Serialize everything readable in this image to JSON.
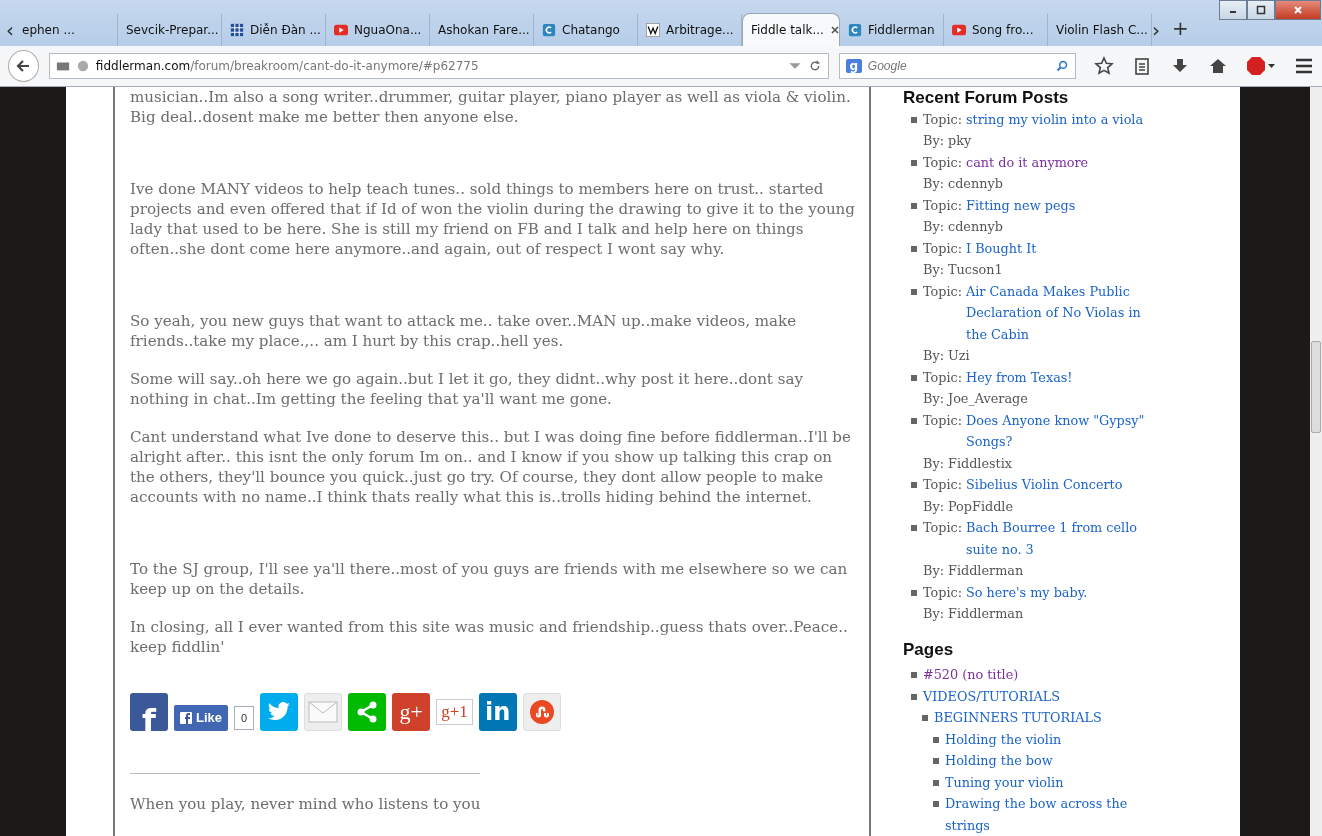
{
  "tabs": [
    {
      "label": "ephen ...",
      "kind": "plain",
      "selected": false
    },
    {
      "label": "Sevcik-Prepar...",
      "kind": "plain",
      "selected": false
    },
    {
      "label": "Diễn Đàn ...",
      "kind": "grid",
      "selected": false
    },
    {
      "label": "NguaOna...",
      "kind": "video",
      "selected": false
    },
    {
      "label": "Ashokan Fare...",
      "kind": "plain",
      "selected": false
    },
    {
      "label": "Chatango",
      "kind": "chat",
      "selected": false
    },
    {
      "label": "Arbitrage...",
      "kind": "wiki",
      "selected": false
    },
    {
      "label": "Fiddle talk...",
      "kind": "plain",
      "selected": true
    },
    {
      "label": "Fiddlerman",
      "kind": "chat",
      "selected": false
    },
    {
      "label": "Song fro...",
      "kind": "video",
      "selected": false
    },
    {
      "label": "Violin Flash C...",
      "kind": "plain",
      "selected": false
    }
  ],
  "tab_controls": {
    "scroll_left": "‹",
    "scroll_right": "›",
    "new_tab": "+"
  },
  "address": {
    "domain": "fiddlerman.com",
    "path": "/forum/breakroom/cant-do-it-anymore/#p62775"
  },
  "search": {
    "engine_letter": "g",
    "placeholder": "Google"
  },
  "post": {
    "paragraphs": [
      {
        "text": "musician..Im also a song writer..drummer, guitar player, piano player as well as viola & violin. Big deal..dosent make me better then anyone else.",
        "spaced_before": false
      },
      {
        "text": "Ive done MANY videos to help teach tunes.. sold things to members here on trust.. started projects and even offered that if Id of won the violin during the drawing to give it to the young lady that used to be here. She is still my friend on FB and I talk and help here on things often..she dont come here anymore..and again, out of respect I wont say why.",
        "spaced_before": true
      },
      {
        "text": "So yeah, you new guys that want to attack me.. take over..MAN up..make videos, make friends..take my place.,.. am I hurt by this crap..hell yes.",
        "spaced_before": true
      },
      {
        "text": "Some will say..oh here we go again..but I let it go, they didnt..why post it here..dont say nothing in chat..Im getting the feeling that ya'll want me gone.",
        "spaced_before": false
      },
      {
        "text": "Cant understand what Ive done to deserve this.. but I was doing fine before fiddlerman..I'll be alright after.. this isnt the only forum Im on.. and I know if you show up talking this crap on the others, they'll bounce you quick..just go try. Of course, they dont allow people to make accounts with no name..I think thats really what this is..trolls hiding behind the internet.",
        "spaced_before": false
      },
      {
        "text": "To the SJ group, I'll see ya'll there..most of you guys are friends with me elsewhere so we can keep up on the details.",
        "spaced_before": true
      },
      {
        "text": "In closing, all I ever wanted from this site was music and friendship..guess thats over..Peace.. keep fiddlin'",
        "spaced_before": false
      }
    ],
    "share": [
      {
        "kind": "facebook",
        "glyph": "f"
      },
      {
        "kind": "like",
        "label": "Like",
        "count": "0"
      },
      {
        "kind": "twitter"
      },
      {
        "kind": "email"
      },
      {
        "kind": "share"
      },
      {
        "kind": "gplus",
        "glyph": "g+"
      },
      {
        "kind": "plusone",
        "glyph": "g+1"
      },
      {
        "kind": "linkedin",
        "glyph": "in"
      },
      {
        "kind": "stumble"
      }
    ],
    "signature": "When you play, never mind who listens to you"
  },
  "sidebar": {
    "recent_heading": "Recent Forum Posts",
    "recent": [
      {
        "prefix": "Topic:",
        "title": "string my violin into a viola",
        "visited": false,
        "author": "By: pky"
      },
      {
        "prefix": "Topic:",
        "title": "cant do it anymore",
        "visited": true,
        "author": "By: cdennyb"
      },
      {
        "prefix": "Topic:",
        "title": "Fitting new pegs",
        "visited": false,
        "author": "By: cdennyb"
      },
      {
        "prefix": "Topic:",
        "title": "I Bought It",
        "visited": false,
        "author": "By: Tucson1"
      },
      {
        "prefix": "Topic:",
        "title": "Air Canada Makes Public Declaration of No Violas in the Cabin",
        "visited": false,
        "author": "By: Uzi"
      },
      {
        "prefix": "Topic:",
        "title": "Hey from Texas!",
        "visited": false,
        "author": "By: Joe_Average"
      },
      {
        "prefix": "Topic:",
        "title": "Does Anyone know \"Gypsy\" Songs?",
        "visited": false,
        "author": "By: Fiddlestix"
      },
      {
        "prefix": "Topic:",
        "title": "Sibelius Violin Concerto",
        "visited": false,
        "author": "By: PopFiddle"
      },
      {
        "prefix": "Topic:",
        "title": "Bach Bourree 1 from cello suite no. 3",
        "visited": false,
        "author": "By: Fiddlerman"
      },
      {
        "prefix": "Topic:",
        "title": "So here's my baby.",
        "visited": false,
        "author": "By: Fiddlerman"
      }
    ],
    "pages_heading": "Pages",
    "pages": [
      {
        "title": "#520 (no title)",
        "visited": true
      },
      {
        "title": "VIDEOS/TUTORIALS",
        "visited": false,
        "children": [
          {
            "title": "BEGINNERS TUTORIALS",
            "visited": false,
            "children": [
              {
                "title": "Holding the violin",
                "visited": false
              },
              {
                "title": "Holding the bow",
                "visited": false
              },
              {
                "title": "Tuning your violin",
                "visited": false
              },
              {
                "title": "Drawing the bow across the strings",
                "visited": false
              }
            ]
          }
        ]
      }
    ]
  }
}
